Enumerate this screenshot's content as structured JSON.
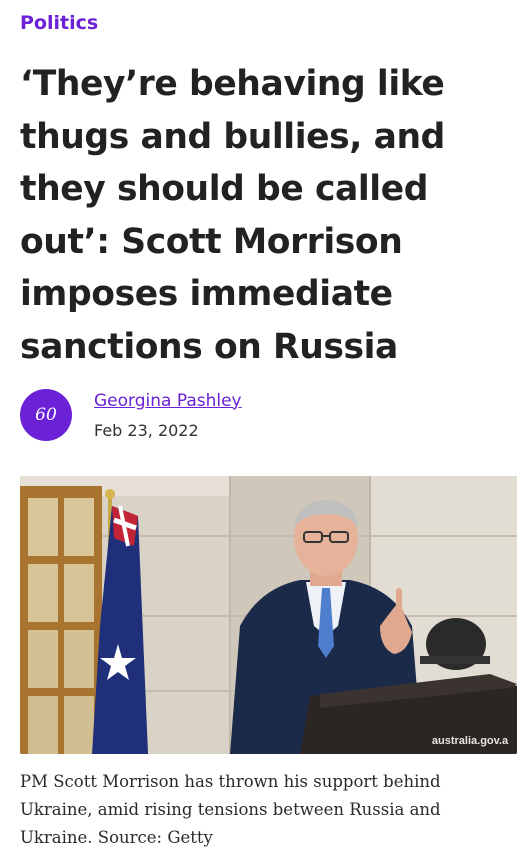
{
  "article": {
    "category": "Politics",
    "headline": "‘They’re behaving like thugs and bullies, and they should be called out’: Scott Morrison imposes immediate sanctions on Russia",
    "author": {
      "name": "Georgina Pashley",
      "avatar_text": "60"
    },
    "date": "Feb 23, 2022",
    "image": {
      "watermark": "australia.gov.a"
    },
    "caption": "PM Scott Morrison has thrown his support behind Ukraine, amid rising tensions between Russia and Ukraine. Source: Getty"
  },
  "colors": {
    "accent": "#6b21d6",
    "headline": "#222222",
    "text": "#2a2a2a"
  }
}
